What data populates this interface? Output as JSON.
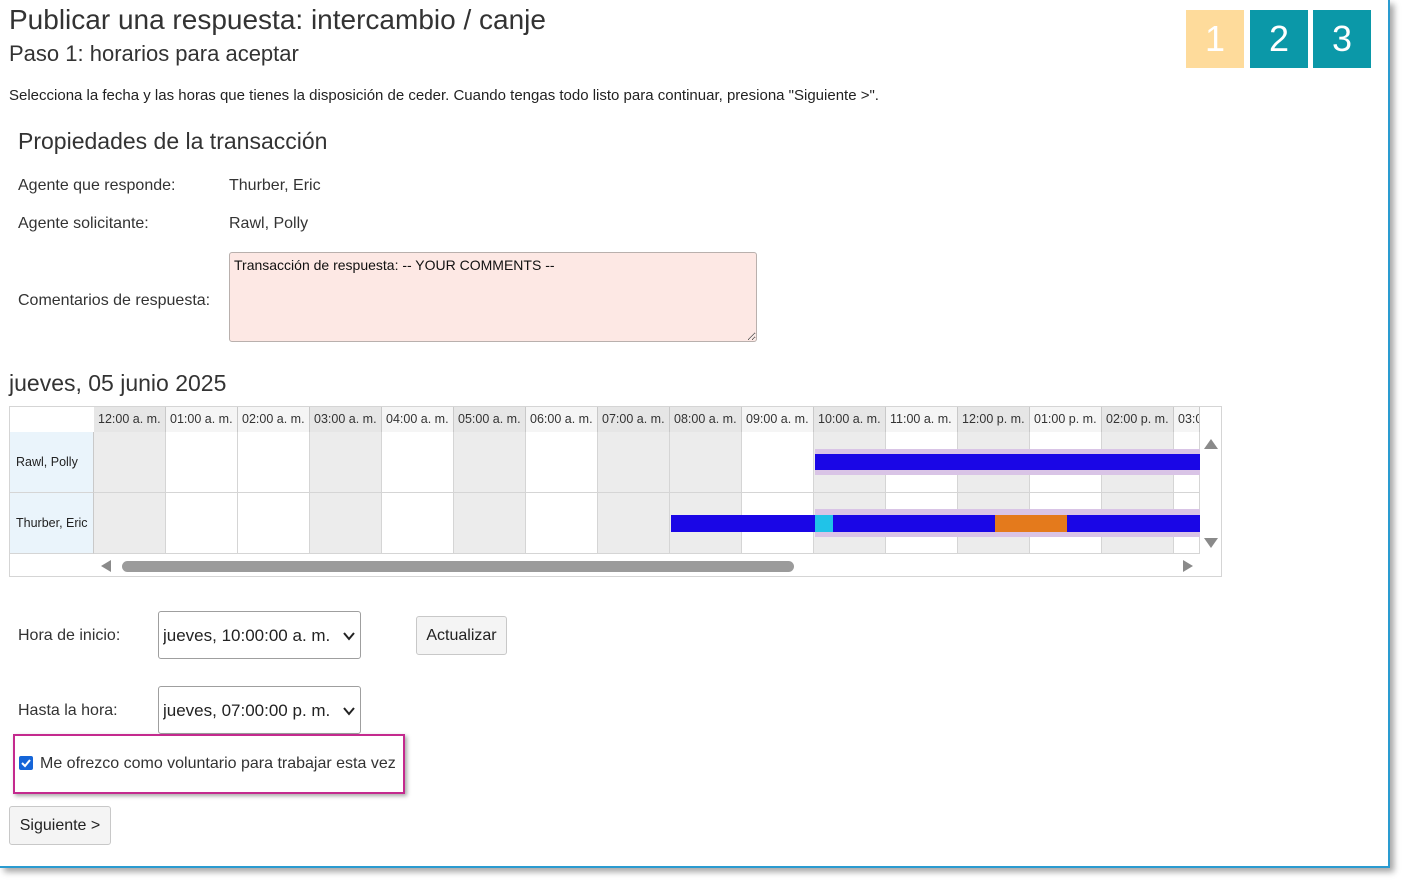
{
  "header": {
    "title": "Publicar una respuesta: intercambio / canje",
    "subtitle": "Paso 1: horarios para aceptar",
    "instructions": "Selecciona la fecha y las horas que tienes la disposición de ceder. Cuando tengas todo listo para continuar, presiona \"Siguiente >\".",
    "steps": [
      {
        "label": "1",
        "color": "#fedb9b",
        "state": "current"
      },
      {
        "label": "2",
        "color": "#0b98a8",
        "state": "pending"
      },
      {
        "label": "3",
        "color": "#0b98a8",
        "state": "pending"
      }
    ]
  },
  "properties": {
    "title": "Propiedades de la transacción",
    "responding_agent_label": "Agente que responde:",
    "responding_agent_value": "Thurber, Eric",
    "requesting_agent_label": "Agente solicitante:",
    "requesting_agent_value": "Rawl, Polly",
    "comments_label": "Comentarios de respuesta:",
    "comments_value": "Transacción de respuesta: -- YOUR COMMENTS --"
  },
  "schedule": {
    "date": "jueves, 05 junio 2025",
    "hours": [
      "12:00 a. m.",
      "01:00 a. m.",
      "02:00 a. m.",
      "03:00 a. m.",
      "04:00 a. m.",
      "05:00 a. m.",
      "06:00 a. m.",
      "07:00 a. m.",
      "08:00 a. m.",
      "09:00 a. m.",
      "10:00 a. m.",
      "11:00 a. m.",
      "12:00 p. m.",
      "01:00 p. m.",
      "02:00 p. m.",
      "03:0"
    ],
    "rows": [
      {
        "name": "Rawl, Polly"
      },
      {
        "name": "Thurber, Eric"
      }
    ],
    "colors": {
      "work": "#1a06e6",
      "break": "#20c3e8",
      "lunch": "#e47a1c",
      "selection": "#d9c4e6",
      "shaded": "#ececec"
    }
  },
  "form": {
    "start_label": "Hora de inicio:",
    "start_value": "jueves, 10:00:00 a. m.",
    "update_button": "Actualizar",
    "end_label": "Hasta la hora:",
    "end_value": "jueves, 07:00:00 p. m.",
    "volunteer_label": "Me ofrezco como voluntario para trabajar esta vez",
    "volunteer_checked": true,
    "next_button": "Siguiente >"
  }
}
